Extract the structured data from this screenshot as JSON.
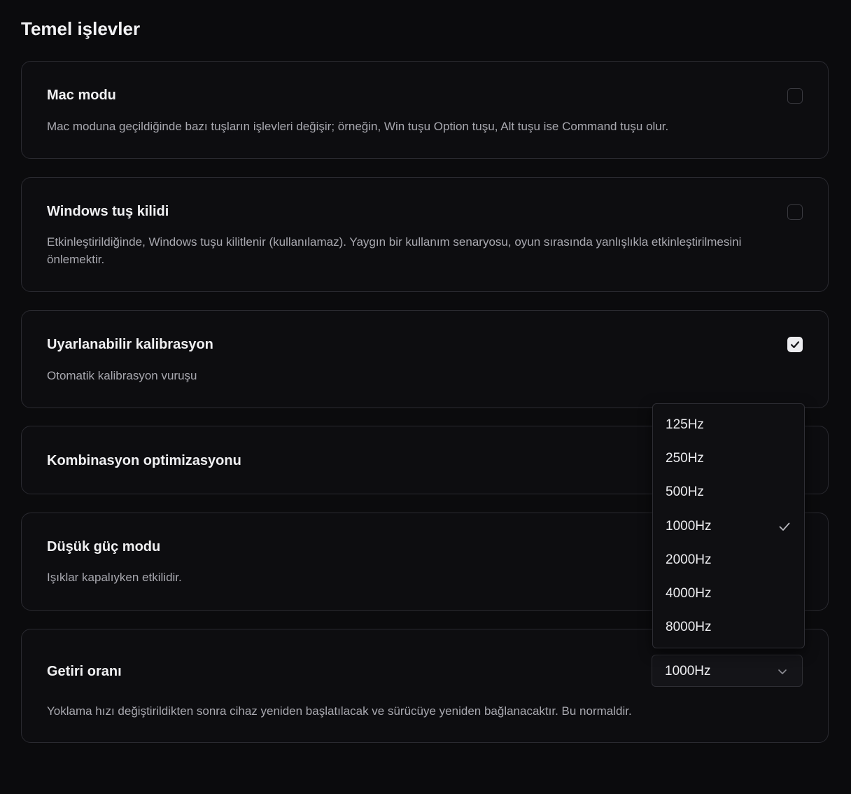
{
  "section": {
    "title": "Temel işlevler"
  },
  "cards": {
    "mac_mode": {
      "title": "Mac modu",
      "description": "Mac moduna geçildiğinde bazı tuşların işlevleri değişir; örneğin, Win tuşu Option tuşu, Alt tuşu ise Command tuşu olur.",
      "checked": false
    },
    "win_lock": {
      "title": "Windows tuş kilidi",
      "description": "Etkinleştirildiğinde, Windows tuşu kilitlenir (kullanılamaz). Yaygın bir kullanım senaryosu, oyun sırasında yanlışlıkla etkinleştirilmesini önlemektir.",
      "checked": false
    },
    "adaptive_calibration": {
      "title": "Uyarlanabilir kalibrasyon",
      "description": "Otomatik kalibrasyon vuruşu",
      "checked": true
    },
    "combo_optimization": {
      "title": "Kombinasyon optimizasyonu"
    },
    "low_power": {
      "title": "Düşük güç modu",
      "description": "Işıklar kapalıyken etkilidir."
    },
    "polling_rate": {
      "title": "Getiri oranı",
      "description": "Yoklama hızı değiştirildikten sonra cihaz yeniden başlatılacak ve sürücüye yeniden bağlanacaktır. Bu normaldir.",
      "selected": "1000Hz"
    }
  },
  "dropdown": {
    "options": [
      "125Hz",
      "250Hz",
      "500Hz",
      "1000Hz",
      "2000Hz",
      "4000Hz",
      "8000Hz"
    ],
    "selected_index": 3
  },
  "icons": {
    "checkmark": "check-icon",
    "chevron": "chevron-down-icon"
  }
}
